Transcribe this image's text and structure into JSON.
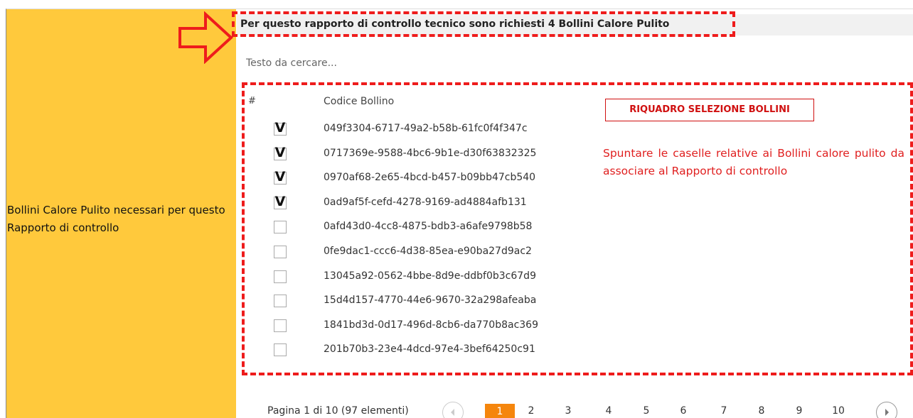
{
  "left_label": "Bollini Calore Pulito necessari per questo Rapporto di controllo",
  "header": {
    "title": "Per questo rapporto di controllo tecnico sono richiesti 4 Bollini Calore Pulito"
  },
  "search": {
    "placeholder": "Testo da cercare..."
  },
  "table": {
    "col_hash": "#",
    "col_code": "Codice Bollino",
    "rows": [
      {
        "code": "049f3304-6717-49a2-b58b-61fc0f4f347c",
        "checked": true
      },
      {
        "code": "0717369e-9588-4bc6-9b1e-d30f63832325",
        "checked": true
      },
      {
        "code": "0970af68-2e65-4bcd-b457-b09bb47cb540",
        "checked": true
      },
      {
        "code": "0ad9af5f-cefd-4278-9169-ad4884afb131",
        "checked": true
      },
      {
        "code": "0afd43d0-4cc8-4875-bdb3-a6afe9798b58",
        "checked": false
      },
      {
        "code": "0fe9dac1-ccc6-4d38-85ea-e90ba27d9ac2",
        "checked": false
      },
      {
        "code": "13045a92-0562-4bbe-8d9e-ddbf0b3c67d9",
        "checked": false
      },
      {
        "code": "15d4d157-4770-44e6-9670-32a298afeaba",
        "checked": false
      },
      {
        "code": "1841bd3d-0d17-496d-8cb6-da770b8ac369",
        "checked": false
      },
      {
        "code": "201b70b3-23e4-4dcd-97e4-3bef64250c91",
        "checked": false
      }
    ],
    "check_glyph": "V"
  },
  "pager": {
    "info": "Pagina 1 di 10 (97 elementi)",
    "pages": [
      "1",
      "2",
      "3",
      "4",
      "5",
      "6",
      "7",
      "8",
      "9",
      "10"
    ],
    "current": "1"
  },
  "annotation": {
    "box_label": "RIQUADRO SELEZIONE BOLLINI",
    "note": "Spuntare le caselle relative ai Bollini calore pulito da associare al Rapporto di controllo"
  },
  "colors": {
    "left_panel": "#ffc93c",
    "annotation_red": "#ee1c1c",
    "active_page": "#f5860d"
  }
}
